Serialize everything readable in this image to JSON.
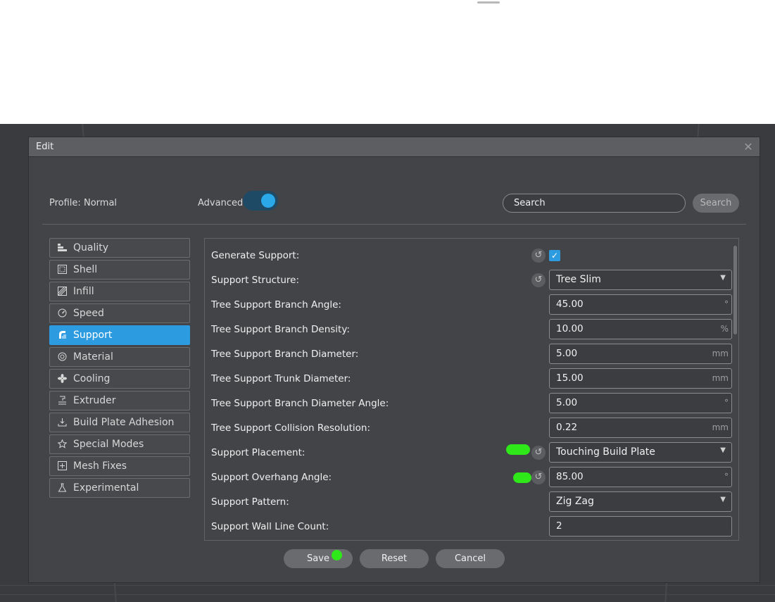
{
  "dialog": {
    "title": "Edit",
    "close_icon": "close-icon"
  },
  "header": {
    "profile_label": "Profile:",
    "profile_value": "Normal",
    "advanced_label": "Advanced",
    "advanced_on": true,
    "search_placeholder": "Search",
    "search_button": "Search"
  },
  "sidebar": {
    "items": [
      {
        "label": "Quality",
        "icon": "quality-icon",
        "active": false
      },
      {
        "label": "Shell",
        "icon": "shell-icon",
        "active": false
      },
      {
        "label": "Infill",
        "icon": "infill-icon",
        "active": false
      },
      {
        "label": "Speed",
        "icon": "speed-icon",
        "active": false
      },
      {
        "label": "Support",
        "icon": "support-icon",
        "active": true
      },
      {
        "label": "Material",
        "icon": "material-icon",
        "active": false
      },
      {
        "label": "Cooling",
        "icon": "cooling-icon",
        "active": false
      },
      {
        "label": "Extruder",
        "icon": "extruder-icon",
        "active": false
      },
      {
        "label": "Build Plate Adhesion",
        "icon": "build-plate-adhesion-icon",
        "active": false
      },
      {
        "label": "Special Modes",
        "icon": "special-modes-icon",
        "active": false
      },
      {
        "label": "Mesh Fixes",
        "icon": "mesh-fixes-icon",
        "active": false
      },
      {
        "label": "Experimental",
        "icon": "experimental-icon",
        "active": false
      }
    ]
  },
  "settings": [
    {
      "label": "Generate Support:",
      "type": "checkbox",
      "checked": true,
      "reset": true
    },
    {
      "label": "Support Structure:",
      "type": "select",
      "value": "Tree Slim",
      "reset": true
    },
    {
      "label": "Tree Support Branch Angle:",
      "type": "number",
      "value": "45.00",
      "unit": "°"
    },
    {
      "label": "Tree Support Branch Density:",
      "type": "number",
      "value": "10.00",
      "unit": "%"
    },
    {
      "label": "Tree Support Branch Diameter:",
      "type": "number",
      "value": "5.00",
      "unit": "mm"
    },
    {
      "label": "Tree Support Trunk Diameter:",
      "type": "number",
      "value": "15.00",
      "unit": "mm"
    },
    {
      "label": "Tree Support Branch Diameter Angle:",
      "type": "number",
      "value": "5.00",
      "unit": "°"
    },
    {
      "label": "Tree Support Collision Resolution:",
      "type": "number",
      "value": "0.22",
      "unit": "mm"
    },
    {
      "label": "Support Placement:",
      "type": "select",
      "value": "Touching Build Plate",
      "reset": true
    },
    {
      "label": "Support Overhang Angle:",
      "type": "number",
      "value": "85.00",
      "unit": "°",
      "reset": true
    },
    {
      "label": "Support Pattern:",
      "type": "select",
      "value": "Zig Zag"
    },
    {
      "label": "Support Wall Line Count:",
      "type": "number",
      "value": "2",
      "unit": ""
    }
  ],
  "buttons": {
    "save": "Save",
    "reset": "Reset",
    "cancel": "Cancel"
  },
  "colors": {
    "accent": "#2d9be0",
    "highlight": "#2ee81a",
    "panel": "#434447"
  }
}
